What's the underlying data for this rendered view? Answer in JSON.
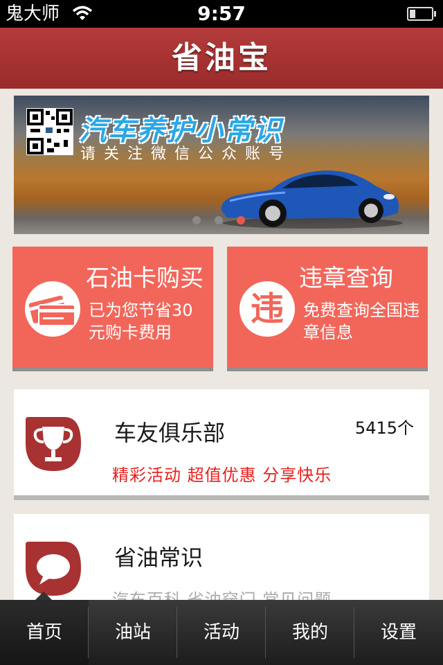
{
  "status_bar": {
    "carrier": "鬼大师",
    "time": "9:57"
  },
  "header": {
    "title": "省油宝"
  },
  "banner": {
    "title": "汽车养护小常识",
    "subtitle": "请关注微信公众账号",
    "slide_count": 3,
    "active_slide": 2
  },
  "tiles": [
    {
      "title": "石油卡购买",
      "desc": "已为您节省30元购卡费用",
      "icon": "credit-card-icon"
    },
    {
      "title": "违章查询",
      "desc": "免费查询全国违章信息",
      "icon": "violation-icon",
      "icon_text": "违"
    }
  ],
  "club": {
    "title": "车友俱乐部",
    "count": "5415个",
    "subtitle": "精彩活动 超值优惠 分享快乐",
    "icon": "trophy-icon"
  },
  "tips": {
    "title": "省油常识",
    "subtitle": "汽车百科 省油窍门 常见问题",
    "icon": "chat-bubble-icon"
  },
  "tab_bar": {
    "tabs": [
      "首页",
      "油站",
      "活动",
      "我的",
      "设置"
    ],
    "active": 0
  },
  "colors": {
    "header": "#a83232",
    "tile": "#f2665a",
    "accent_red": "#e8201e",
    "background": "#ece7e1"
  }
}
